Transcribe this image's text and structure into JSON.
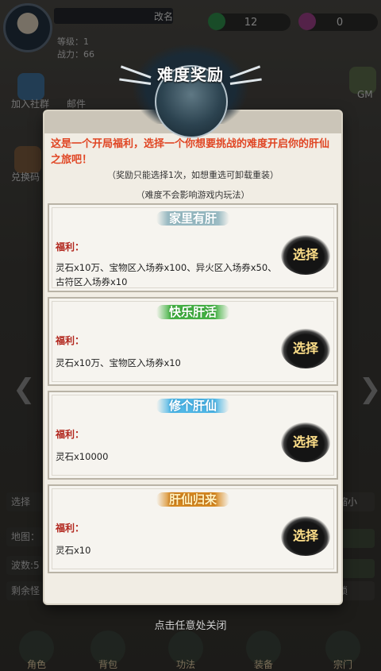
{
  "modal": {
    "title": "难度奖励",
    "intro": "这是一个开局福利，选择一个你想要挑战的难度开启你的肝仙之旅吧！",
    "note1": "（奖励只能选择1次，如想重选可卸载重装）",
    "note2": "（难度不会影响游戏内玩法）",
    "options": [
      {
        "title": "家里有肝",
        "benefit_label": "福利：",
        "reward": "灵石x10万、宝物区入场券x100、异火区入场券x50、古符区入场券x10",
        "button": "选择"
      },
      {
        "title": "快乐肝活",
        "benefit_label": "福利：",
        "reward": "灵石x10万、宝物区入场券x10",
        "button": "选择"
      },
      {
        "title": "修个肝仙",
        "benefit_label": "福利：",
        "reward": "灵石x10000",
        "button": "选择"
      },
      {
        "title": "肝仙归来",
        "benefit_label": "福利：",
        "reward": "灵石x10",
        "button": "选择"
      }
    ],
    "close_hint": "点击任意处关闭"
  },
  "background": {
    "rename": "改名",
    "level": "等级：1",
    "power": "战力：66",
    "currency1": "12",
    "currency2": "0",
    "side_left_1": "加入社群",
    "side_left_2": "邮件",
    "side_left_3": "兑换码",
    "side_right_1": "GM",
    "row_select": "选择",
    "row_map": "地图：",
    "row_wave": "波数:5",
    "row_remain": "剩余怪",
    "right_btn_1": "缩小",
    "right_btn_3": "锁",
    "bottom_tabs": [
      "角色",
      "背包",
      "功法",
      "装备",
      "宗门"
    ]
  },
  "colors": {
    "intro_red": "#e04624",
    "benefit_red": "#b2271e",
    "button_text": "#ffe08a",
    "modal_bg": "#f1ede4"
  }
}
